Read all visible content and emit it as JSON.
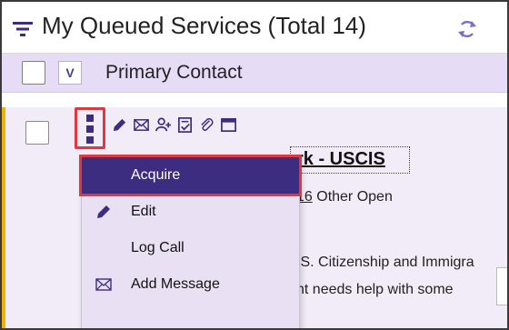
{
  "header": {
    "title": "My Queued Services (Total 14)",
    "menu_icon": "hamburger-filter-icon",
    "refresh_icon": "refresh-icon"
  },
  "column_header": {
    "sort_label": "V",
    "label": "Primary Contact"
  },
  "row": {
    "title_partial": "rk - USCIS",
    "open_count": "16",
    "open_suffix": " Other Open",
    "service_partial": ".S. Citizenship and Immigra",
    "desc_partial": "nt needs help with some",
    "accent_color": "#f0b400"
  },
  "row_actions": [
    {
      "icon": "pencil-icon"
    },
    {
      "icon": "envelope-icon"
    },
    {
      "icon": "add-person-icon"
    },
    {
      "icon": "form-check-icon"
    },
    {
      "icon": "paperclip-icon"
    },
    {
      "icon": "window-icon"
    }
  ],
  "menu": {
    "items": [
      {
        "label": "Acquire",
        "icon": ""
      },
      {
        "label": "Edit",
        "icon": "pencil-icon"
      },
      {
        "label": "Log Call",
        "icon": ""
      },
      {
        "label": "Add Message",
        "icon": "envelope-icon"
      }
    ],
    "highlight_color": "#3d2d80",
    "callout_color": "#e0383f"
  }
}
